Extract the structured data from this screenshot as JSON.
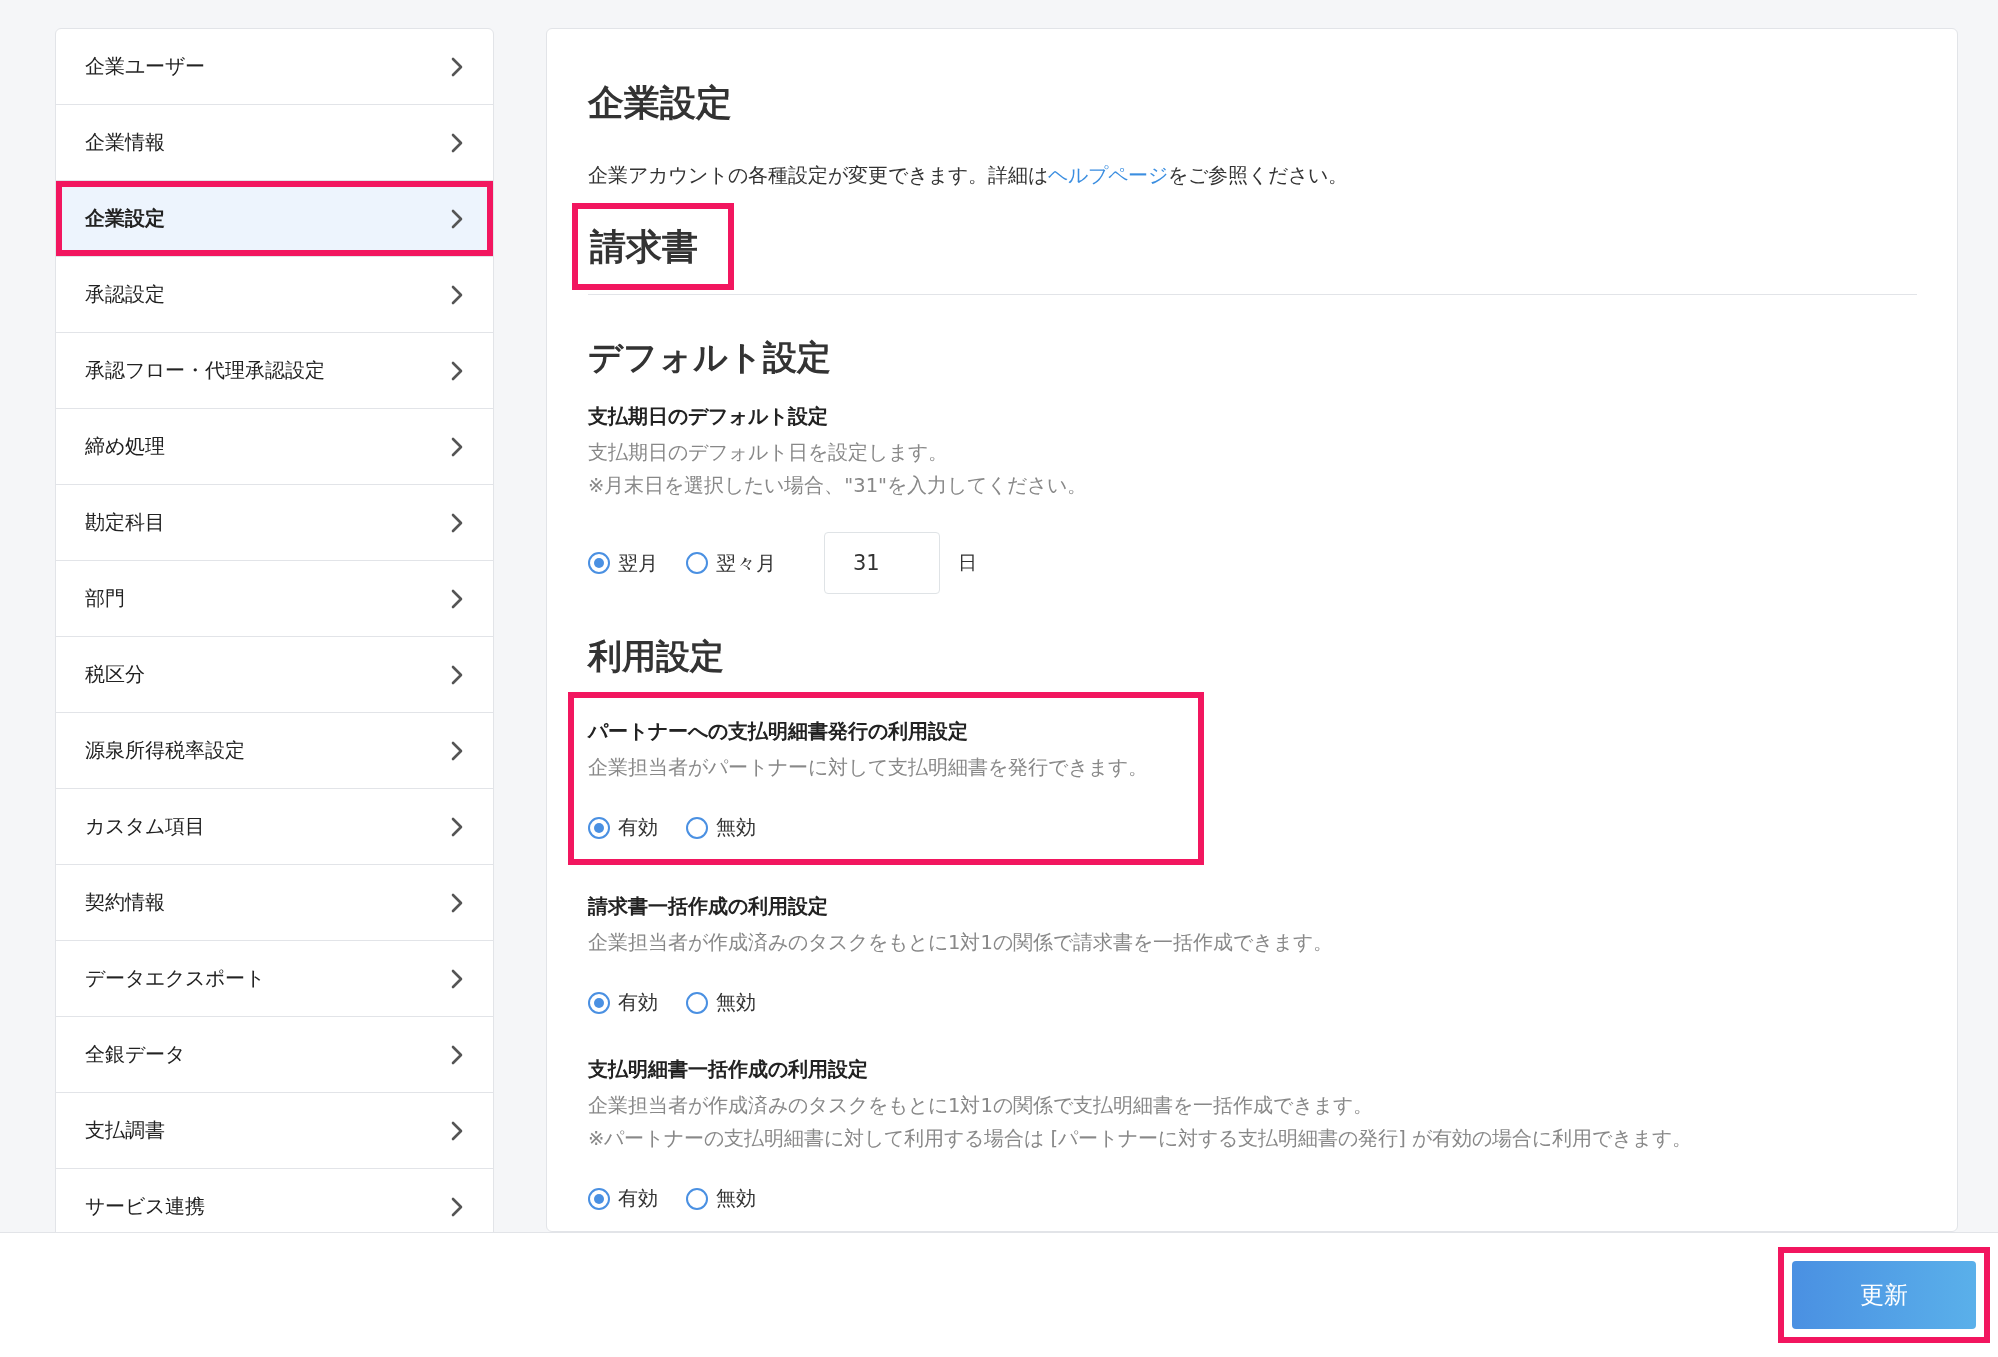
{
  "sidebar": {
    "items": [
      {
        "label": "企業ユーザー",
        "selected": false,
        "highlighted": false
      },
      {
        "label": "企業情報",
        "selected": false,
        "highlighted": false
      },
      {
        "label": "企業設定",
        "selected": true,
        "highlighted": true
      },
      {
        "label": "承認設定",
        "selected": false,
        "highlighted": false
      },
      {
        "label": "承認フロー・代理承認設定",
        "selected": false,
        "highlighted": false
      },
      {
        "label": "締め処理",
        "selected": false,
        "highlighted": false
      },
      {
        "label": "勘定科目",
        "selected": false,
        "highlighted": false
      },
      {
        "label": "部門",
        "selected": false,
        "highlighted": false
      },
      {
        "label": "税区分",
        "selected": false,
        "highlighted": false
      },
      {
        "label": "源泉所得税率設定",
        "selected": false,
        "highlighted": false
      },
      {
        "label": "カスタム項目",
        "selected": false,
        "highlighted": false
      },
      {
        "label": "契約情報",
        "selected": false,
        "highlighted": false
      },
      {
        "label": "データエクスポート",
        "selected": false,
        "highlighted": false
      },
      {
        "label": "全銀データ",
        "selected": false,
        "highlighted": false
      },
      {
        "label": "支払調書",
        "selected": false,
        "highlighted": false
      },
      {
        "label": "サービス連携",
        "selected": false,
        "highlighted": false
      }
    ]
  },
  "main": {
    "title": "企業設定",
    "description": "企業アカウントの各種設定が変更できます。詳細は",
    "help_link": "ヘルプページ",
    "description_end": "をご参照ください。",
    "section": {
      "title": "請求書",
      "highlighted": true
    },
    "groups": [
      {
        "title": "デフォルト設定",
        "settings": [
          {
            "kind": "due_date",
            "label": "支払期日のデフォルト設定",
            "highlighted": false,
            "notes": [
              "支払期日のデフォルト日を設定します。",
              "※月末日を選択したい場合、\"31\"を入力してください。"
            ],
            "options": [
              {
                "label": "翌月",
                "selected": true
              },
              {
                "label": "翌々月",
                "selected": false
              }
            ],
            "day_input": {
              "value": "31"
            },
            "unit": "日"
          }
        ]
      },
      {
        "title": "利用設定",
        "settings": [
          {
            "kind": "toggle",
            "label": "パートナーへの支払明細書発行の利用設定",
            "highlighted": true,
            "notes": [
              "企業担当者がパートナーに対して支払明細書を発行できます。"
            ],
            "options": [
              {
                "label": "有効",
                "selected": true
              },
              {
                "label": "無効",
                "selected": false
              }
            ]
          },
          {
            "kind": "toggle",
            "label": "請求書一括作成の利用設定",
            "highlighted": false,
            "notes": [
              "企業担当者が作成済みのタスクをもとに1対1の関係で請求書を一括作成できます。"
            ],
            "options": [
              {
                "label": "有効",
                "selected": true
              },
              {
                "label": "無効",
                "selected": false
              }
            ]
          },
          {
            "kind": "toggle",
            "label": "支払明細書一括作成の利用設定",
            "highlighted": false,
            "notes": [
              "企業担当者が作成済みのタスクをもとに1対1の関係で支払明細書を一括作成できます。",
              "※パートナーの支払明細書に対して利用する場合は [パートナーに対する支払明細書の発行] が有効の場合に利用できます。"
            ],
            "options": [
              {
                "label": "有効",
                "selected": true
              },
              {
                "label": "無効",
                "selected": false
              }
            ]
          }
        ]
      }
    ]
  },
  "footer": {
    "button": {
      "label": "更新",
      "highlighted": true
    }
  }
}
